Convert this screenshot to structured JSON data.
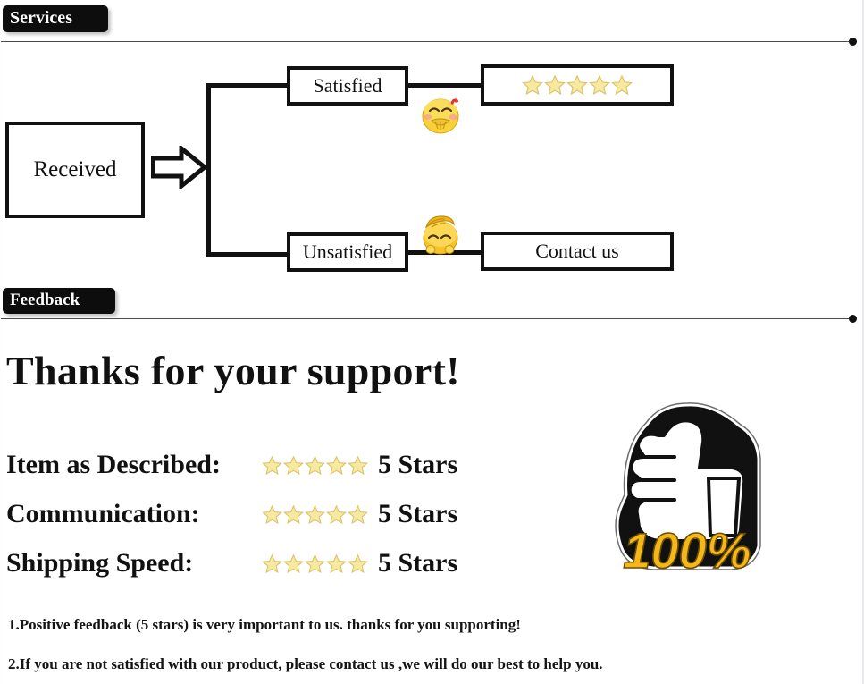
{
  "sections": [
    {
      "id": "services",
      "label": "Services"
    },
    {
      "id": "feedback",
      "label": "Feedback"
    }
  ],
  "flowchart": {
    "start_box": {
      "label": "Received"
    },
    "arrow": {
      "name": "right-block-arrow"
    },
    "branches": [
      {
        "condition": "Satisfied",
        "emoji": "happy-blushing-face-emoji",
        "outcome": "★★★★★",
        "outcome_type": "five-star-rating",
        "stars": 5
      },
      {
        "condition": "Unsatisfied",
        "emoji": "facepalm-sad-face-emoji",
        "outcome": "Contact us",
        "outcome_type": "text",
        "stars": 0
      }
    ]
  },
  "feedback": {
    "heading": "Thanks for your support!",
    "ratings": [
      {
        "label": "Item as Described:",
        "stars": 5,
        "value": "5 Stars"
      },
      {
        "label": "Communication:",
        "stars": 5,
        "value": "5 Stars"
      },
      {
        "label": "Shipping Speed:",
        "stars": 5,
        "value": "5 Stars"
      }
    ],
    "badge": {
      "name": "thumbs-up-100-percent-badge",
      "text": "100%"
    },
    "notes": [
      "1.Positive feedback (5 stars) is very important to us. thanks for you supporting!",
      "2.If you are not satisfied with our product, please contact us ,we will do our best to help you."
    ]
  },
  "colors": {
    "ink": "#111111",
    "tab_bg": "#0d0d0d",
    "tab_text": "#ffffff",
    "star_fill": "#f7e9a0",
    "star_stroke": "#d9c268",
    "badge_gold": "#f5b81b",
    "page_bg": "#ffffff",
    "rule": "#4a4a4a"
  }
}
